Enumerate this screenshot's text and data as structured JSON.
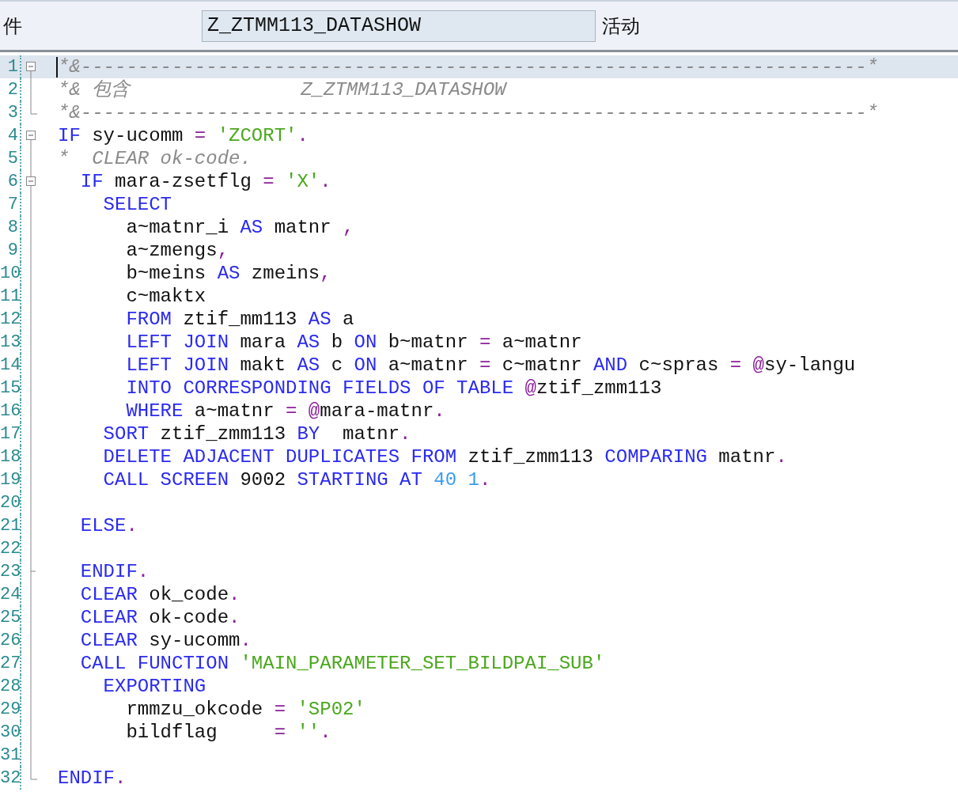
{
  "header": {
    "label": "件",
    "program_field": {
      "value": "Z_ZTMM113_DATASHOW"
    },
    "status": "活动"
  },
  "editor": {
    "lines": [
      {
        "number": "1",
        "current": true,
        "kind": "open",
        "tokens": [
          {
            "kind": "cmt",
            "text": "*&---------------------------------------------------------------------*"
          }
        ]
      },
      {
        "number": "2",
        "current": false,
        "kind": "line",
        "tokens": [
          {
            "kind": "cmt",
            "text": "*& 包含               Z_ZTMM113_DATASHOW"
          }
        ]
      },
      {
        "number": "3",
        "current": false,
        "kind": "end",
        "tokens": [
          {
            "kind": "cmt",
            "text": "*&---------------------------------------------------------------------*"
          }
        ]
      },
      {
        "number": "4",
        "current": false,
        "kind": "open",
        "tokens": [
          {
            "kind": "kw",
            "text": "IF"
          },
          {
            "kind": "id",
            "text": " sy-ucomm "
          },
          {
            "kind": "op",
            "text": "="
          },
          {
            "kind": "str",
            "text": " 'ZCORT'"
          },
          {
            "kind": "op",
            "text": "."
          }
        ]
      },
      {
        "number": "5",
        "current": false,
        "kind": "line",
        "tokens": [
          {
            "kind": "cmt",
            "text": "*  CLEAR ok-code."
          }
        ]
      },
      {
        "number": "6",
        "current": false,
        "kind": "open-inner",
        "tokens": [
          {
            "kind": "kw",
            "text": "  IF"
          },
          {
            "kind": "id",
            "text": " mara-zsetflg "
          },
          {
            "kind": "op",
            "text": "="
          },
          {
            "kind": "str",
            "text": " 'X'"
          },
          {
            "kind": "op",
            "text": "."
          }
        ]
      },
      {
        "number": "7",
        "current": false,
        "kind": "line",
        "tokens": [
          {
            "kind": "kw",
            "text": "    SELECT"
          }
        ]
      },
      {
        "number": "8",
        "current": false,
        "kind": "line",
        "tokens": [
          {
            "kind": "id",
            "text": "      a~matnr_i "
          },
          {
            "kind": "kw",
            "text": "AS"
          },
          {
            "kind": "id",
            "text": " matnr "
          },
          {
            "kind": "op",
            "text": ","
          }
        ]
      },
      {
        "number": "9",
        "current": false,
        "kind": "line",
        "tokens": [
          {
            "kind": "id",
            "text": "      a~zmengs"
          },
          {
            "kind": "op",
            "text": ","
          }
        ]
      },
      {
        "number": "10",
        "current": false,
        "kind": "line",
        "tokens": [
          {
            "kind": "id",
            "text": "      b~meins "
          },
          {
            "kind": "kw",
            "text": "AS"
          },
          {
            "kind": "id",
            "text": " zmeins"
          },
          {
            "kind": "op",
            "text": ","
          }
        ]
      },
      {
        "number": "11",
        "current": false,
        "kind": "line",
        "tokens": [
          {
            "kind": "id",
            "text": "      c~maktx"
          }
        ]
      },
      {
        "number": "12",
        "current": false,
        "kind": "line",
        "tokens": [
          {
            "kind": "kw",
            "text": "      FROM"
          },
          {
            "kind": "id",
            "text": " ztif_mm113 "
          },
          {
            "kind": "kw",
            "text": "AS"
          },
          {
            "kind": "id",
            "text": " a"
          }
        ]
      },
      {
        "number": "13",
        "current": false,
        "kind": "line",
        "tokens": [
          {
            "kind": "kw",
            "text": "      LEFT JOIN"
          },
          {
            "kind": "id",
            "text": " mara "
          },
          {
            "kind": "kw",
            "text": "AS"
          },
          {
            "kind": "id",
            "text": " b "
          },
          {
            "kind": "kw",
            "text": "ON"
          },
          {
            "kind": "id",
            "text": " b~matnr "
          },
          {
            "kind": "op",
            "text": "="
          },
          {
            "kind": "id",
            "text": " a~matnr"
          }
        ]
      },
      {
        "number": "14",
        "current": false,
        "kind": "line",
        "tokens": [
          {
            "kind": "kw",
            "text": "      LEFT JOIN"
          },
          {
            "kind": "id",
            "text": " makt "
          },
          {
            "kind": "kw",
            "text": "AS"
          },
          {
            "kind": "id",
            "text": " c "
          },
          {
            "kind": "kw",
            "text": "ON"
          },
          {
            "kind": "id",
            "text": " a~matnr "
          },
          {
            "kind": "op",
            "text": "="
          },
          {
            "kind": "id",
            "text": " c~matnr "
          },
          {
            "kind": "kw",
            "text": "AND"
          },
          {
            "kind": "id",
            "text": " c~spras "
          },
          {
            "kind": "op",
            "text": "= @"
          },
          {
            "kind": "id",
            "text": "sy-langu"
          }
        ]
      },
      {
        "number": "15",
        "current": false,
        "kind": "line",
        "tokens": [
          {
            "kind": "kw",
            "text": "      INTO CORRESPONDING FIELDS OF TABLE"
          },
          {
            "kind": "op",
            "text": " @"
          },
          {
            "kind": "id",
            "text": "ztif_zmm113"
          }
        ]
      },
      {
        "number": "16",
        "current": false,
        "kind": "line",
        "tokens": [
          {
            "kind": "kw",
            "text": "      WHERE"
          },
          {
            "kind": "id",
            "text": " a~matnr "
          },
          {
            "kind": "op",
            "text": "= @"
          },
          {
            "kind": "id",
            "text": "mara-matnr"
          },
          {
            "kind": "op",
            "text": "."
          }
        ]
      },
      {
        "number": "17",
        "current": false,
        "kind": "line",
        "tokens": [
          {
            "kind": "kw",
            "text": "    SORT"
          },
          {
            "kind": "id",
            "text": " ztif_zmm113 "
          },
          {
            "kind": "kw",
            "text": "BY"
          },
          {
            "kind": "id",
            "text": "  matnr"
          },
          {
            "kind": "op",
            "text": "."
          }
        ]
      },
      {
        "number": "18",
        "current": false,
        "kind": "line",
        "tokens": [
          {
            "kind": "kw",
            "text": "    DELETE ADJACENT DUPLICATES FROM"
          },
          {
            "kind": "id",
            "text": " ztif_zmm113 "
          },
          {
            "kind": "kw",
            "text": "COMPARING"
          },
          {
            "kind": "id",
            "text": " matnr"
          },
          {
            "kind": "op",
            "text": "."
          }
        ]
      },
      {
        "number": "19",
        "current": false,
        "kind": "line",
        "tokens": [
          {
            "kind": "kw",
            "text": "    CALL SCREEN"
          },
          {
            "kind": "id",
            "text": " 9002 "
          },
          {
            "kind": "kw",
            "text": "STARTING AT"
          },
          {
            "kind": "num",
            "text": " 40 1"
          },
          {
            "kind": "op",
            "text": "."
          }
        ]
      },
      {
        "number": "20",
        "current": false,
        "kind": "line"
      },
      {
        "number": "21",
        "current": false,
        "kind": "line",
        "tokens": [
          {
            "kind": "kw",
            "text": "  ELSE"
          },
          {
            "kind": "op",
            "text": "."
          }
        ]
      },
      {
        "number": "22",
        "current": false,
        "kind": "line"
      },
      {
        "number": "23",
        "current": false,
        "kind": "inner-end",
        "tokens": [
          {
            "kind": "kw",
            "text": "  ENDIF"
          },
          {
            "kind": "op",
            "text": "."
          }
        ]
      },
      {
        "number": "24",
        "current": false,
        "kind": "line",
        "tokens": [
          {
            "kind": "kw",
            "text": "  CLEAR"
          },
          {
            "kind": "id",
            "text": " ok_code"
          },
          {
            "kind": "op",
            "text": "."
          }
        ]
      },
      {
        "number": "25",
        "current": false,
        "kind": "line",
        "tokens": [
          {
            "kind": "kw",
            "text": "  CLEAR"
          },
          {
            "kind": "id",
            "text": " ok-code"
          },
          {
            "kind": "op",
            "text": "."
          }
        ]
      },
      {
        "number": "26",
        "current": false,
        "kind": "line",
        "tokens": [
          {
            "kind": "kw",
            "text": "  CLEAR"
          },
          {
            "kind": "id",
            "text": " sy-ucomm"
          },
          {
            "kind": "op",
            "text": "."
          }
        ]
      },
      {
        "number": "27",
        "current": false,
        "kind": "line",
        "tokens": [
          {
            "kind": "kw",
            "text": "  CALL FUNCTION"
          },
          {
            "kind": "str",
            "text": " 'MAIN_PARAMETER_SET_BILDPAI_SUB'"
          }
        ]
      },
      {
        "number": "28",
        "current": false,
        "kind": "line",
        "tokens": [
          {
            "kind": "kw",
            "text": "    EXPORTING"
          }
        ]
      },
      {
        "number": "29",
        "current": false,
        "kind": "line",
        "tokens": [
          {
            "kind": "id",
            "text": "      rmmzu_okcode "
          },
          {
            "kind": "op",
            "text": "="
          },
          {
            "kind": "str",
            "text": " 'SP02'"
          }
        ]
      },
      {
        "number": "30",
        "current": false,
        "kind": "line",
        "tokens": [
          {
            "kind": "id",
            "text": "      bildflag     "
          },
          {
            "kind": "op",
            "text": "="
          },
          {
            "kind": "str",
            "text": " ''"
          },
          {
            "kind": "op",
            "text": "."
          }
        ]
      },
      {
        "number": "31",
        "current": false,
        "kind": "line"
      },
      {
        "number": "32",
        "current": false,
        "kind": "end",
        "tokens": [
          {
            "kind": "kw",
            "text": "ENDIF"
          },
          {
            "kind": "op",
            "text": "."
          }
        ]
      }
    ]
  }
}
